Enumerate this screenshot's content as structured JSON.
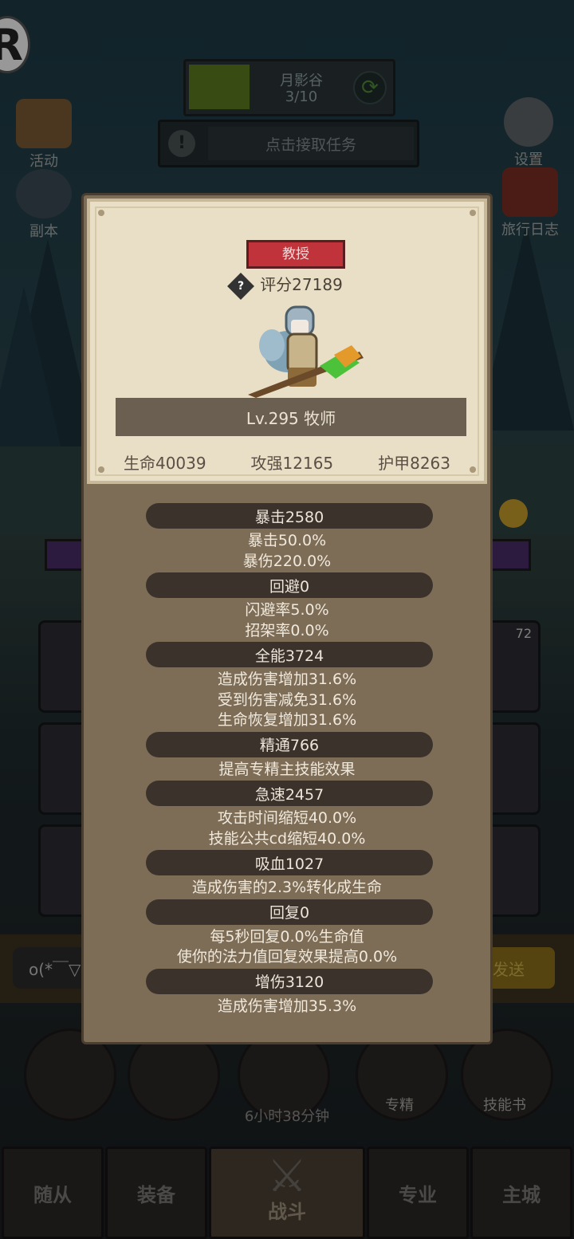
{
  "hud": {
    "logo_letter": "R",
    "location_name": "月影谷",
    "location_progress": "3/10",
    "task_prompt": "点击接取任务",
    "left_buttons": [
      "活动",
      "副本"
    ],
    "right_buttons": [
      "设置",
      "旅行日志"
    ]
  },
  "background": {
    "slot_badge": "72",
    "chat_placeholder": "o(*￣▽",
    "send_label": "发送",
    "round_buttons": [
      "专精",
      "技能书"
    ],
    "timer": "6小时38分钟",
    "tabs": [
      "随从",
      "装备",
      "战斗",
      "专业",
      "主城"
    ],
    "active_tab": "战斗"
  },
  "character": {
    "title": "教授",
    "score": "评分27189",
    "help_symbol": "?",
    "level_class": "Lv.295 牧师",
    "stats": [
      "生命40039",
      "攻强12165",
      "护甲8263"
    ]
  },
  "attributes": [
    {
      "header": "暴击2580",
      "lines": [
        "暴击50.0%",
        "暴伤220.0%"
      ]
    },
    {
      "header": "回避0",
      "lines": [
        "闪避率5.0%",
        "招架率0.0%"
      ]
    },
    {
      "header": "全能3724",
      "lines": [
        "造成伤害增加31.6%",
        "受到伤害减免31.6%",
        "生命恢复增加31.6%"
      ]
    },
    {
      "header": "精通766",
      "lines": [
        "提高专精主技能效果"
      ]
    },
    {
      "header": "急速2457",
      "lines": [
        "攻击时间缩短40.0%",
        "技能公共cd缩短40.0%"
      ]
    },
    {
      "header": "吸血1027",
      "lines": [
        "造成伤害的2.3%转化成生命"
      ]
    },
    {
      "header": "回复0",
      "lines": [
        "每5秒回复0.0%生命值",
        "使你的法力值回复效果提高0.0%"
      ]
    },
    {
      "header": "增伤3120",
      "lines": [
        "造成伤害增加35.3%"
      ]
    }
  ]
}
